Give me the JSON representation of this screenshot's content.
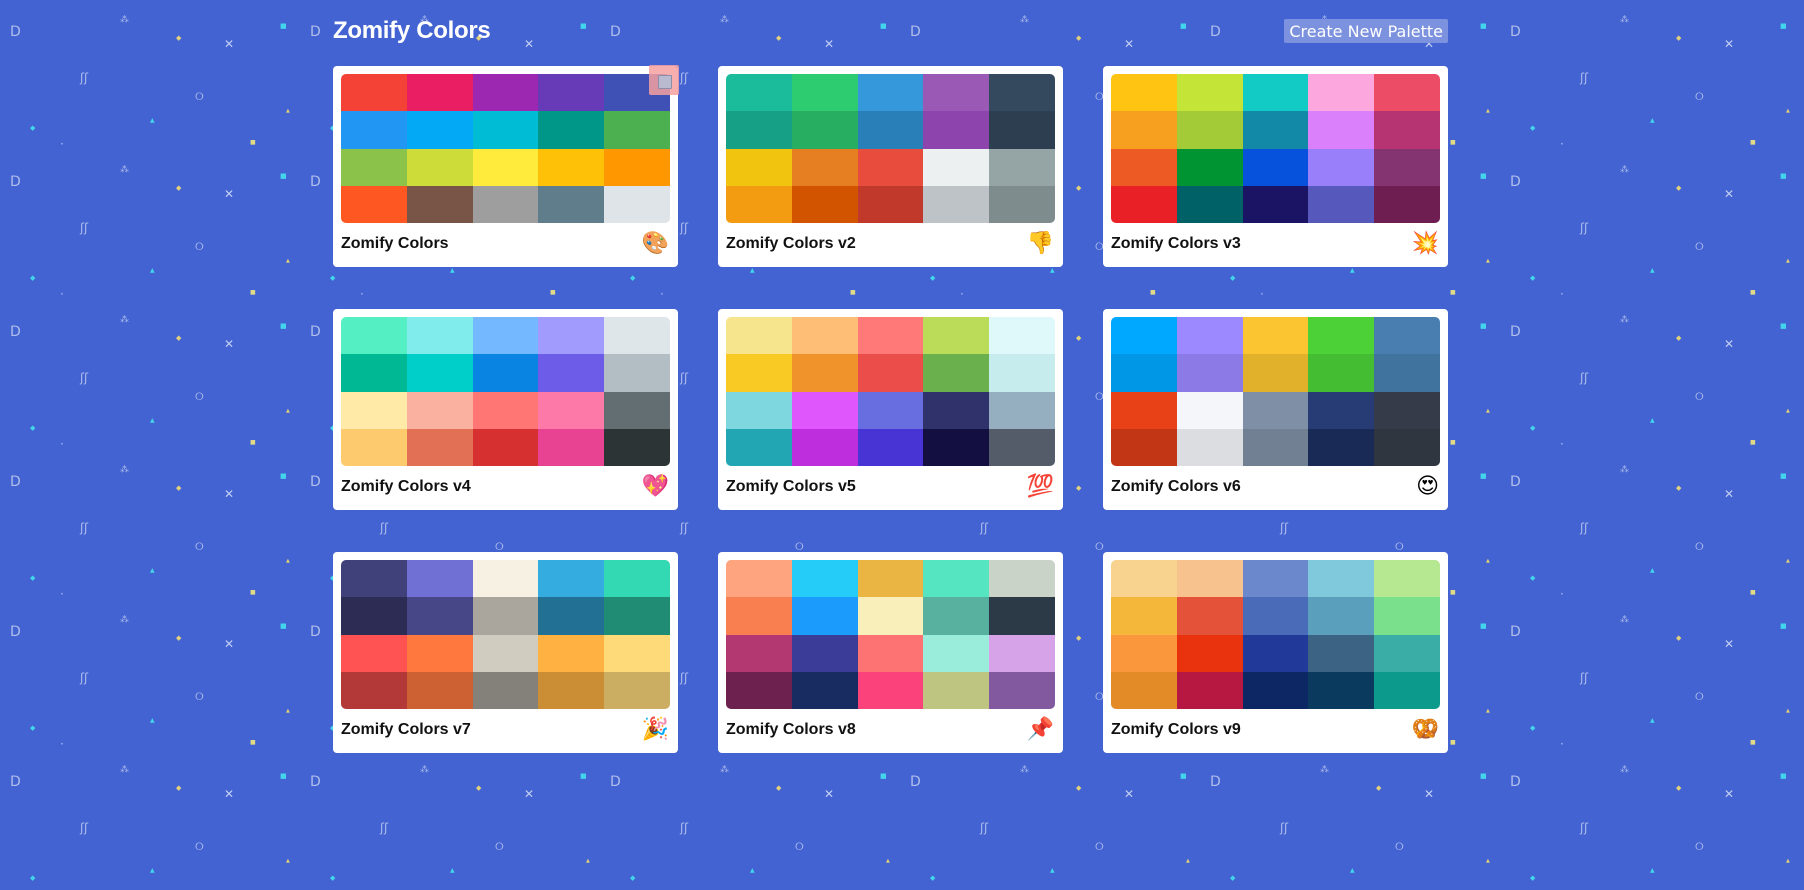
{
  "app": {
    "title": "Zomify Colors",
    "create_button_label": "Create New Palette"
  },
  "colors": {
    "background": "#4263d1",
    "card": "#ffffff",
    "button_bg": "#7d92de"
  },
  "palettes": [
    {
      "name": "Zomify Colors",
      "emoji": "🎨",
      "colors": [
        "#f44336",
        "#e91e63",
        "#9c27b0",
        "#673ab7",
        "#3f51b5",
        "#2196f3",
        "#03a9f4",
        "#00bcd4",
        "#009688",
        "#4caf50",
        "#8bc34a",
        "#cddc39",
        "#ffeb3b",
        "#ffc107",
        "#ff9800",
        "#ff5722",
        "#795548",
        "#9e9e9e",
        "#607d8b",
        "#dfe4e8"
      ]
    },
    {
      "name": "Zomify Colors v2",
      "emoji": "👎",
      "colors": [
        "#1abc9c",
        "#2ecc71",
        "#3498db",
        "#9b59b6",
        "#34495e",
        "#16a085",
        "#27ae60",
        "#2980b9",
        "#8e44ad",
        "#2c3e50",
        "#f1c40f",
        "#e67e22",
        "#e74c3c",
        "#ecf0f1",
        "#95a5a6",
        "#f39c12",
        "#d35400",
        "#c0392b",
        "#bdc3c7",
        "#7f8c8d"
      ]
    },
    {
      "name": "Zomify Colors v3",
      "emoji": "💥",
      "colors": [
        "#ffc312",
        "#c4e538",
        "#12cbc4",
        "#fda7df",
        "#ed4c67",
        "#f79f1f",
        "#a3cb38",
        "#1289a7",
        "#d980fa",
        "#b53471",
        "#ee5a24",
        "#009432",
        "#0652dd",
        "#9980fa",
        "#833471",
        "#ea2027",
        "#006266",
        "#1b1464",
        "#5758bb",
        "#6f1e51"
      ]
    },
    {
      "name": "Zomify Colors v4",
      "emoji": "💖",
      "colors": [
        "#55efc4",
        "#81ecec",
        "#74b9ff",
        "#a29bfe",
        "#dfe6e9",
        "#00b894",
        "#00cec9",
        "#0984e3",
        "#6c5ce7",
        "#b2bec3",
        "#ffeaa7",
        "#fab1a0",
        "#ff7675",
        "#fd79a8",
        "#636e72",
        "#fdcb6e",
        "#e17055",
        "#d63031",
        "#e84393",
        "#2d3436"
      ]
    },
    {
      "name": "Zomify Colors v5",
      "emoji": "💯",
      "colors": [
        "#f6e58d",
        "#ffbe76",
        "#ff7979",
        "#badc58",
        "#dff9fb",
        "#f9ca24",
        "#f0932b",
        "#eb4d4b",
        "#6ab04c",
        "#c7ecee",
        "#7ed6df",
        "#e056fd",
        "#686de0",
        "#30336b",
        "#95afc0",
        "#22a6b3",
        "#be2edd",
        "#4834d4",
        "#130f40",
        "#535c68"
      ]
    },
    {
      "name": "Zomify Colors v6",
      "emoji": "😍",
      "colors": [
        "#00a8ff",
        "#9c88ff",
        "#fbc531",
        "#4cd137",
        "#487eb0",
        "#0097e6",
        "#8c7ae6",
        "#e1b12c",
        "#44bd32",
        "#40739e",
        "#e84118",
        "#f5f6fa",
        "#7f8fa6",
        "#273c75",
        "#353b48",
        "#c23616",
        "#dcdde1",
        "#718093",
        "#192a56",
        "#2f3640"
      ]
    },
    {
      "name": "Zomify Colors v7",
      "emoji": "🎉",
      "colors": [
        "#40407a",
        "#706fd3",
        "#f7f1e3",
        "#34ace0",
        "#33d9b2",
        "#2c2c54",
        "#474787",
        "#aaa69d",
        "#227093",
        "#218c74",
        "#ff5252",
        "#ff793f",
        "#d1ccc0",
        "#ffb142",
        "#ffda79",
        "#b33939",
        "#cd6133",
        "#84817a",
        "#cc8e35",
        "#ccae62"
      ]
    },
    {
      "name": "Zomify Colors v8",
      "emoji": "📌",
      "colors": [
        "#fea47f",
        "#25ccf7",
        "#eab543",
        "#55e6c1",
        "#cad3c8",
        "#f97f51",
        "#1b9cfc",
        "#f8efba",
        "#58b19f",
        "#2c3a47",
        "#b33771",
        "#3b3b98",
        "#fd7272",
        "#9aecdb",
        "#d6a2e8",
        "#6d214f",
        "#182c61",
        "#fc427b",
        "#bdc581",
        "#82589f"
      ]
    },
    {
      "name": "Zomify Colors v9",
      "emoji": "🥨",
      "colors": [
        "#f8d38f",
        "#f8c28f",
        "#6b88cc",
        "#80c8dc",
        "#b6e892",
        "#f5b73a",
        "#e5523a",
        "#4a6bb8",
        "#5aa0bd",
        "#7ae08c",
        "#fa963c",
        "#e9320e",
        "#213a99",
        "#3c6384",
        "#3aaea6",
        "#e38c27",
        "#b71842",
        "#0c2764",
        "#0a3b5e",
        "#0c9a8c"
      ]
    }
  ]
}
